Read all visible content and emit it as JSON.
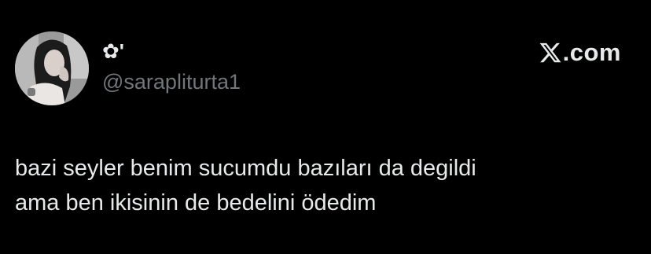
{
  "author": {
    "display_name": "✿'",
    "handle": "@sarapliturta1",
    "avatar_icon": "profile-photo"
  },
  "brand": {
    "icon": "x-logo-icon",
    "domain": ".com"
  },
  "tweet": {
    "lines": [
      "bazi seyler benim sucumdu bazıları da degildi",
      "ama ben ikisinin de bedelini ödedim"
    ]
  },
  "colors": {
    "background": "#000000",
    "text_primary": "#e7e9ea",
    "text_secondary": "#71767b"
  }
}
